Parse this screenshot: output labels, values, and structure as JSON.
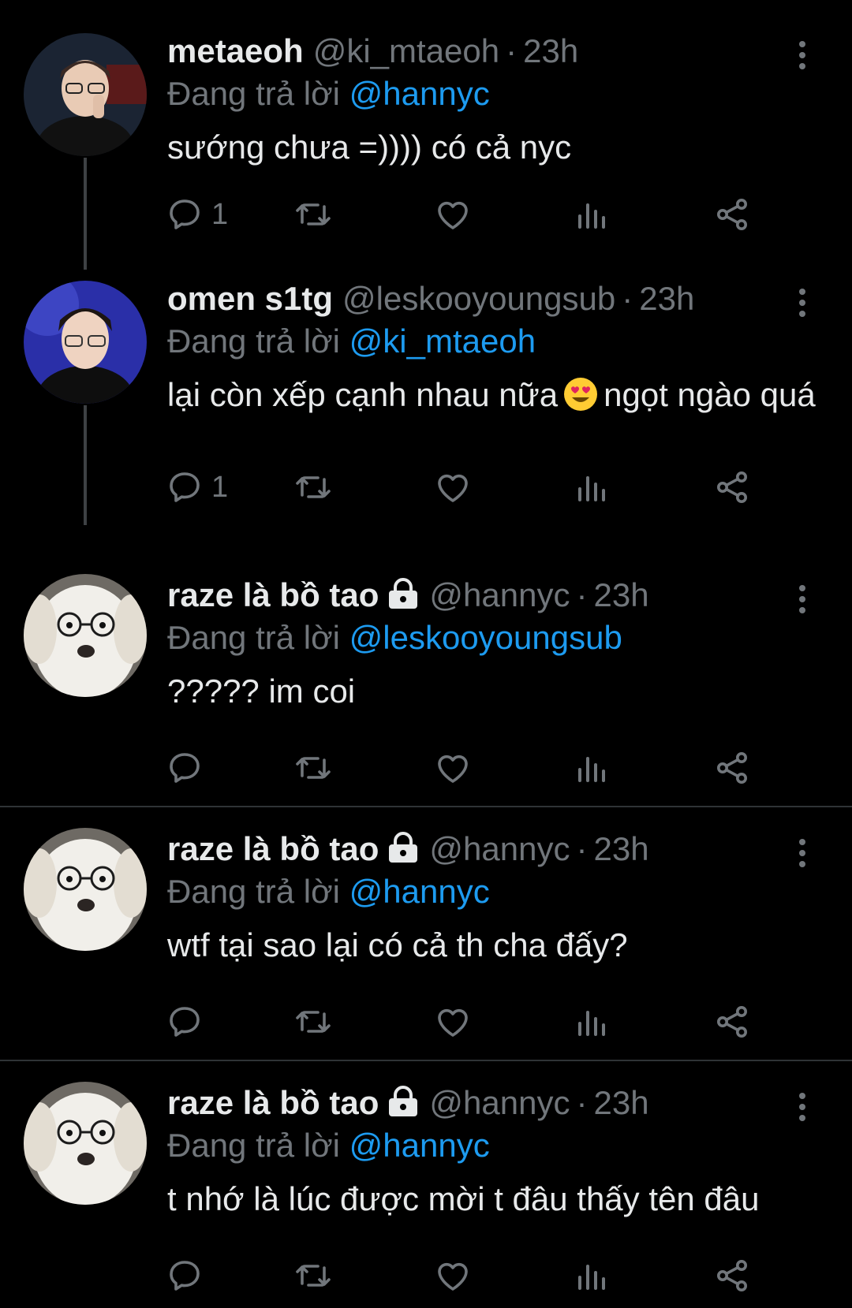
{
  "tweets": [
    {
      "name": "metaeoh",
      "handle": "@ki_mtaeoh",
      "dot": "·",
      "time": "23h",
      "replying_prefix": "Đang trả lời",
      "replying_to": "@hannyc",
      "text": "sướng chưa =)))) có cả nyc",
      "reply_count": "1",
      "locked": false
    },
    {
      "name": "omen s1tg",
      "handle": "@leskooyoungsub",
      "dot": "·",
      "time": "23h",
      "replying_prefix": "Đang trả lời",
      "replying_to": "@ki_mtaeoh",
      "text_before_emoji": "lại còn xếp cạnh nhau nữa",
      "text_after_emoji": "ngọt ngào quá",
      "emoji": "smiling-face-with-heart-eyes",
      "reply_count": "1",
      "locked": false
    },
    {
      "name": "raze là bồ tao",
      "handle": "@hannyc",
      "dot": "·",
      "time": "23h",
      "replying_prefix": "Đang trả lời",
      "replying_to": "@leskooyoungsub",
      "text": "????? im coi",
      "reply_count": "",
      "locked": true
    },
    {
      "name": "raze là bồ tao",
      "handle": "@hannyc",
      "dot": "·",
      "time": "23h",
      "replying_prefix": "Đang trả lời",
      "replying_to": "@hannyc",
      "text": "wtf tại sao lại có cả th cha đấy?",
      "reply_count": "",
      "locked": true
    },
    {
      "name": "raze là bồ tao",
      "handle": "@hannyc",
      "dot": "·",
      "time": "23h",
      "replying_prefix": "Đang trả lời",
      "replying_to": "@hannyc",
      "text": "t nhớ là lúc được mời t đâu thấy tên đâu",
      "reply_count": "",
      "locked": true
    }
  ],
  "icons": [
    "reply-icon",
    "retweet-icon",
    "like-icon",
    "views-icon",
    "share-icon",
    "more-options-icon",
    "lock-icon"
  ],
  "colors": {
    "background": "#000000",
    "text": "#e7e9ea",
    "secondary": "#71767b",
    "mention": "#1d9bf0",
    "separator": "#2f3336"
  }
}
